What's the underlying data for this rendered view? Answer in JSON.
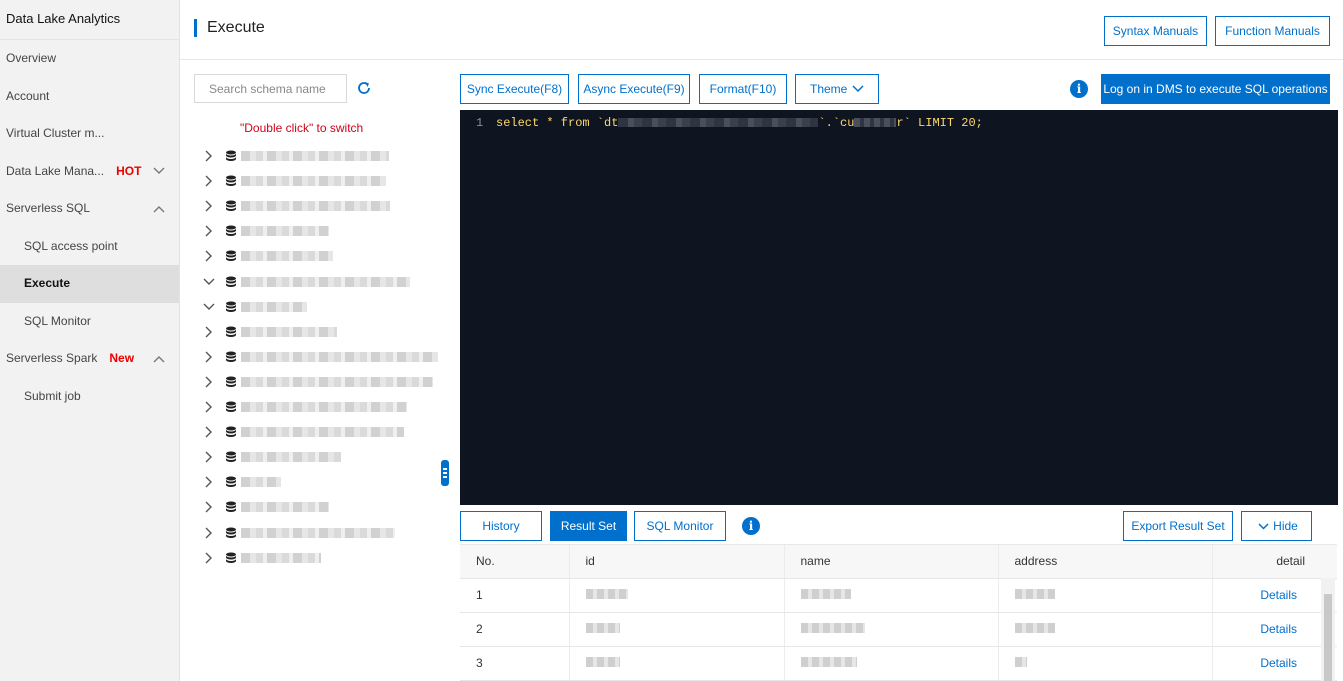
{
  "sidebar": {
    "title": "Data Lake Analytics",
    "items": [
      {
        "label": "Overview"
      },
      {
        "label": "Account"
      },
      {
        "label": "Virtual Cluster m..."
      },
      {
        "label": "Data Lake Mana...",
        "tag": "HOT",
        "chevron": "chevron-down-icon"
      },
      {
        "label": "Serverless SQL",
        "chevron": "chevron-up-icon"
      },
      {
        "label": "SQL access point"
      },
      {
        "label": "Execute"
      },
      {
        "label": "SQL Monitor"
      },
      {
        "label": "Serverless Spark",
        "tag": "New",
        "chevron": "chevron-up-icon"
      },
      {
        "label": "Submit job"
      }
    ]
  },
  "header": {
    "title": "Execute",
    "syntax_manuals": "Syntax Manuals",
    "function_manuals": "Function Manuals"
  },
  "schema": {
    "search_placeholder": "Search schema name",
    "hint": "\"Double click\" to switch"
  },
  "toolbar": {
    "sync_execute": "Sync Execute(F8)",
    "async_execute": "Async Execute(F9)",
    "format": "Format(F10)",
    "theme": "Theme",
    "dms_login": "Log on in DMS to execute SQL operations"
  },
  "editor": {
    "line_number": "1",
    "code_prefix": "select * from `dt",
    "code_mid": "`.`cu",
    "code_suffix": "r` LIMIT 20;"
  },
  "results": {
    "tabs": {
      "history": "History",
      "result_set": "Result Set",
      "sql_monitor": "SQL Monitor"
    },
    "export": "Export Result Set",
    "hide": "Hide",
    "columns": {
      "no": "No.",
      "id": "id",
      "name": "name",
      "address": "address",
      "detail": "detail"
    },
    "rows": [
      {
        "no": "1",
        "detail": "Details"
      },
      {
        "no": "2",
        "detail": "Details"
      },
      {
        "no": "3",
        "detail": "Details"
      }
    ]
  },
  "colors": {
    "accent": "#0070cc",
    "tag_red": "#e00000",
    "editor_bg": "#0f1421"
  }
}
